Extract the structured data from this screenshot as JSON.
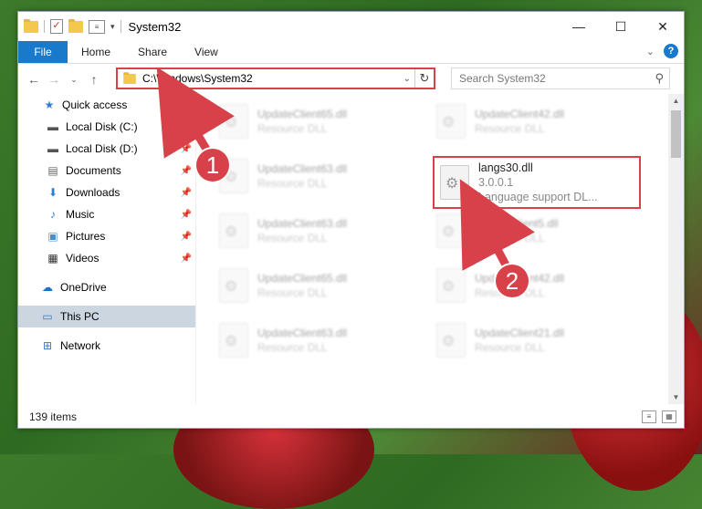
{
  "window": {
    "title": "System32",
    "controls": {
      "minimize": "—",
      "maximize": "☐",
      "close": "✕"
    }
  },
  "ribbon": {
    "tabs": [
      "File",
      "Home",
      "Share",
      "View"
    ]
  },
  "address": {
    "path": "C:\\Windows\\System32"
  },
  "search": {
    "placeholder": "Search System32"
  },
  "sidebar": {
    "quick_access": "Quick access",
    "items": [
      {
        "label": "Local Disk (C:)",
        "icon": "drive-icon"
      },
      {
        "label": "Local Disk (D:)",
        "icon": "drive-icon"
      },
      {
        "label": "Documents",
        "icon": "documents-icon"
      },
      {
        "label": "Downloads",
        "icon": "downloads-icon"
      },
      {
        "label": "Music",
        "icon": "music-icon"
      },
      {
        "label": "Pictures",
        "icon": "pictures-icon"
      },
      {
        "label": "Videos",
        "icon": "videos-icon"
      }
    ],
    "onedrive": "OneDrive",
    "this_pc": "This PC",
    "network": "Network"
  },
  "files": {
    "left": [
      {
        "name": "UpdateClient65.dll",
        "type": "Resource DLL"
      },
      {
        "name": "UpdateClient63.dll",
        "type": "Resource DLL"
      },
      {
        "name": "UpdateClient63.dll",
        "type": "Resource DLL"
      },
      {
        "name": "UpdateClient65.dll",
        "type": "Resource DLL"
      },
      {
        "name": "UpdateClient63.dll",
        "type": "Resource DLL"
      }
    ],
    "right": [
      {
        "name": "UpdateClient42.dll",
        "type": "Resource DLL"
      },
      {
        "name": "UpdateClient5.dll",
        "type": "Resource DLL"
      },
      {
        "name": "UpdateClient42.dll",
        "type": "Resource DLL"
      },
      {
        "name": "UpdateClient21.dll",
        "type": "Resource DLL"
      }
    ],
    "highlighted": {
      "name": "langs30.dll",
      "version": "3.0.0.1",
      "description": "Language support DL..."
    }
  },
  "status": {
    "item_count": "139 items"
  },
  "callouts": [
    "1",
    "2"
  ],
  "colors": {
    "highlight": "#d9414a",
    "file_tab": "#1979ca",
    "selected_nav": "#ccd6e0"
  }
}
